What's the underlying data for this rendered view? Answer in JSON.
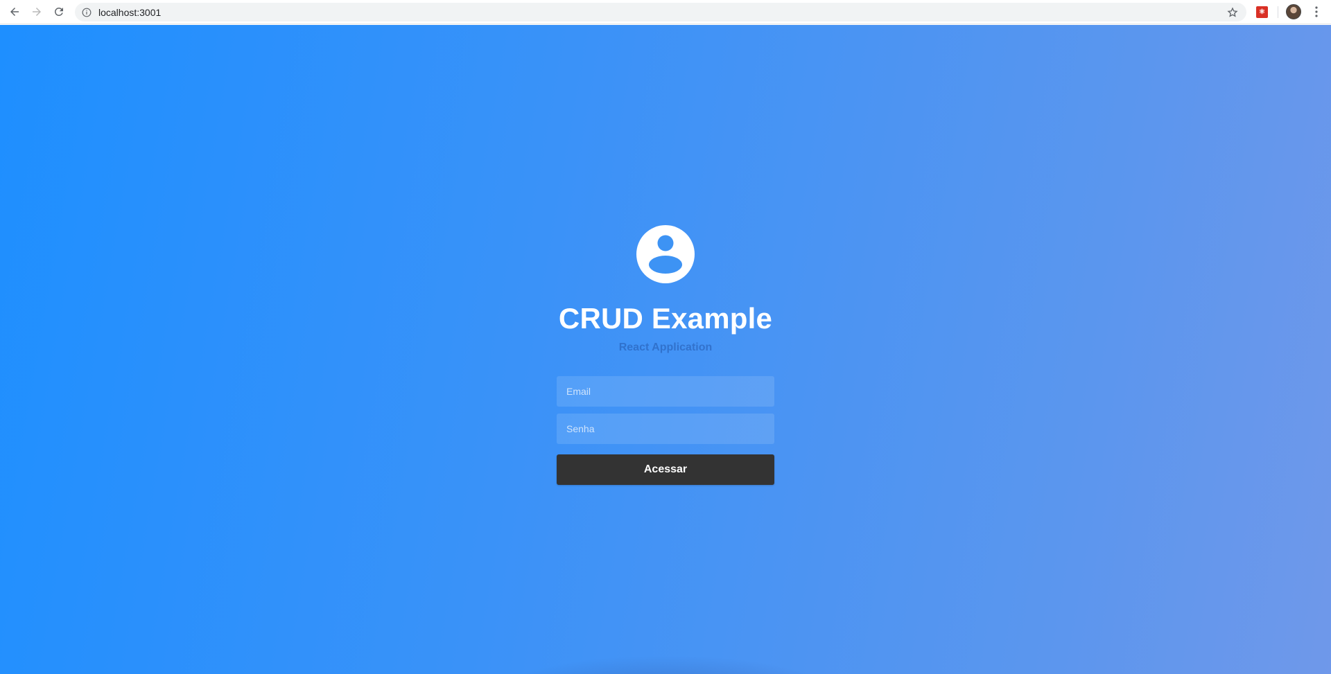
{
  "browser": {
    "url": "localhost:3001",
    "icons": {
      "back": "arrow-left-icon",
      "forward": "arrow-right-icon",
      "reload": "reload-icon",
      "info": "info-icon",
      "star": "star-icon",
      "extension": "extension-icon",
      "profile": "profile-avatar",
      "menu": "kebab-menu-icon"
    }
  },
  "login": {
    "icon": "user-circle-icon",
    "title": "CRUD Example",
    "subtitle": "React Application",
    "email_placeholder": "Email",
    "password_placeholder": "Senha",
    "submit_label": "Acessar"
  },
  "colors": {
    "gradient_start": "#1e8fff",
    "gradient_end": "#6f98ea",
    "button_bg": "#333333",
    "text_white": "#ffffff"
  }
}
